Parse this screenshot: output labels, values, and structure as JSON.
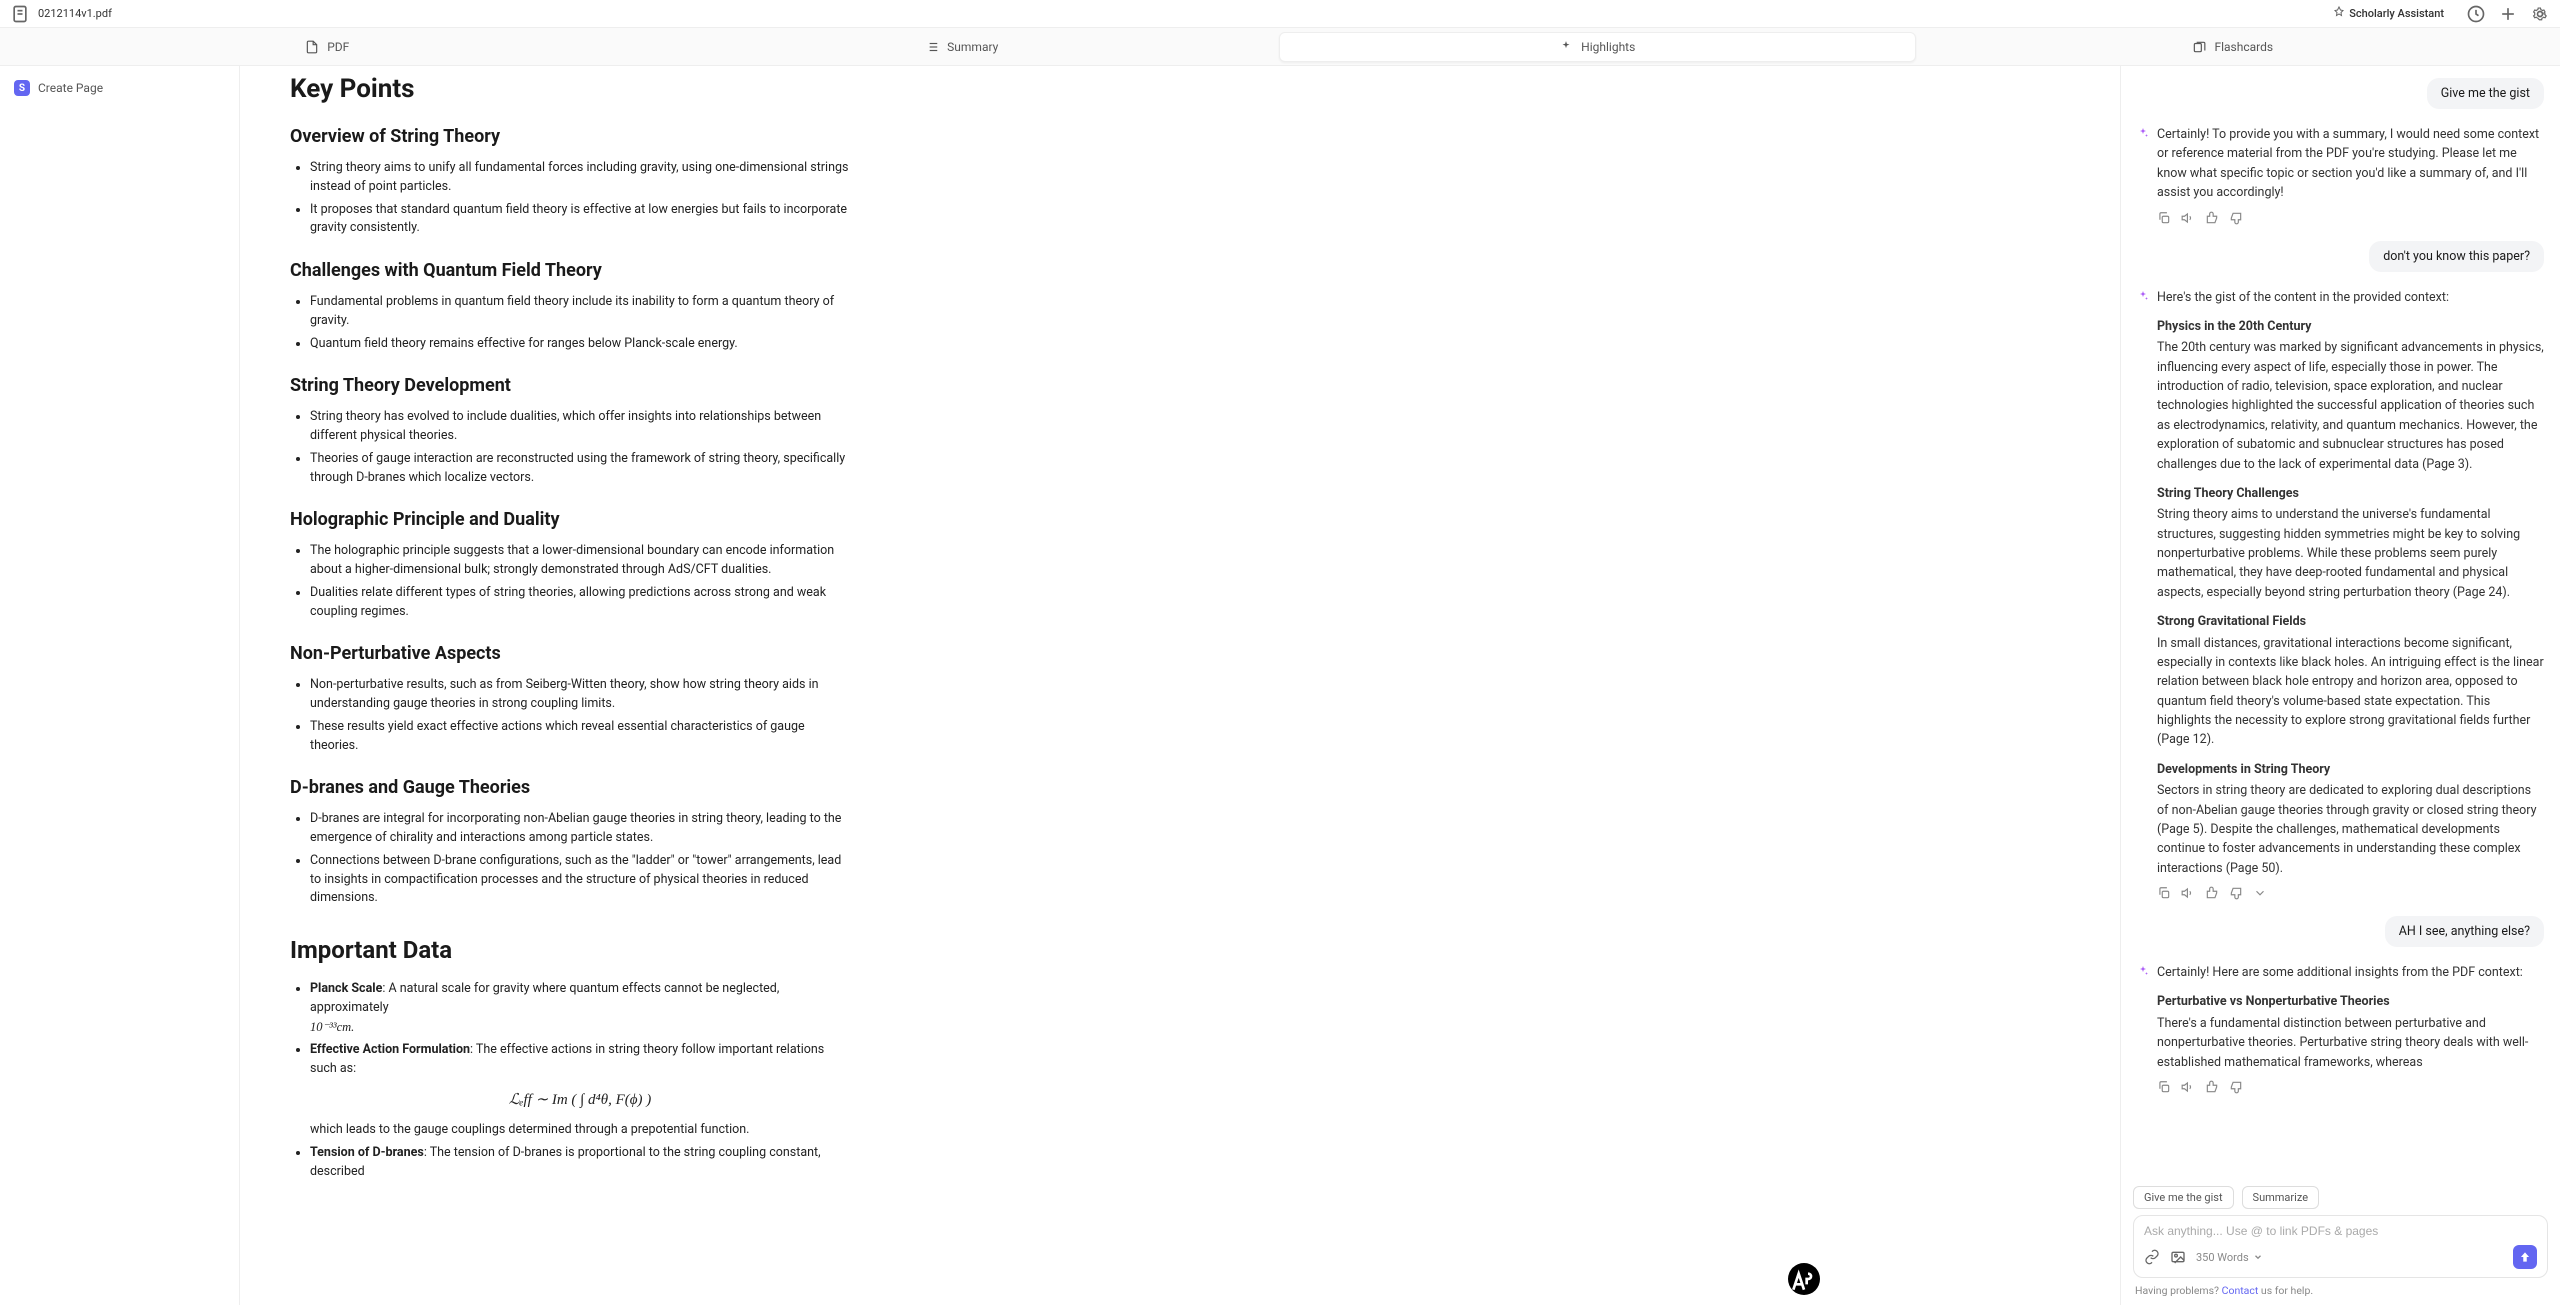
{
  "topbar": {
    "filename": "0212114v1.pdf",
    "assistant_label": "Scholarly Assistant"
  },
  "tabs": {
    "pdf": "PDF",
    "summary": "Summary",
    "highlights": "Highlights",
    "flashcards": "Flashcards"
  },
  "left_rail": {
    "create_page": "Create Page"
  },
  "content": {
    "ghost": "",
    "title": "Key Points",
    "sections": [
      {
        "heading": "Overview of String Theory",
        "items": [
          "String theory aims to unify all fundamental forces including gravity, using one-dimensional strings instead of point particles.",
          "It proposes that standard quantum field theory is effective at low energies but fails to incorporate gravity consistently."
        ]
      },
      {
        "heading": "Challenges with Quantum Field Theory",
        "items": [
          "Fundamental problems in quantum field theory include its inability to form a quantum theory of gravity.",
          "Quantum field theory remains effective for ranges below Planck-scale energy."
        ]
      },
      {
        "heading": "String Theory Development",
        "items": [
          "String theory has evolved to include dualities, which offer insights into relationships between different physical theories.",
          "Theories of gauge interaction are reconstructed using the framework of string theory, specifically through D-branes which localize vectors."
        ]
      },
      {
        "heading": "Holographic Principle and Duality",
        "items": [
          "The holographic principle suggests that a lower-dimensional boundary can encode information about a higher-dimensional bulk; strongly demonstrated through AdS/CFT dualities.",
          "Dualities relate different types of string theories, allowing predictions across strong and weak coupling regimes."
        ]
      },
      {
        "heading": "Non-Perturbative Aspects",
        "items": [
          "Non-perturbative results, such as from Seiberg-Witten theory, show how string theory aids in understanding gauge theories in strong coupling limits.",
          "These results yield exact effective actions which reveal essential characteristics of gauge theories."
        ]
      },
      {
        "heading": "D-branes and Gauge Theories",
        "items": [
          "D-branes are integral for incorporating non-Abelian gauge theories in string theory, leading to the emergence of chirality and interactions among particle states.",
          "Connections between D-brane configurations, such as the \"ladder\" or \"tower\" arrangements, lead to insights in compactification processes and the structure of physical theories in reduced dimensions."
        ]
      }
    ],
    "important_heading": "Important Data",
    "important": {
      "planck_label": "Planck Scale",
      "planck_text": ": A natural scale for gravity where quantum effects cannot be neglected, approximately ",
      "planck_math": "10⁻³³cm.",
      "action_label": "Effective Action Formulation",
      "action_text": ": The effective actions in string theory follow important relations such as:",
      "action_math": "ℒₑff ∼ Im ( ∫ d⁴θ, F(ϕ) )",
      "action_tail": "which leads to the gauge couplings determined through a prepotential function.",
      "tension_label": "Tension of D-branes",
      "tension_text": ": The tension of D-branes is proportional to the string coupling constant, described"
    }
  },
  "chat": {
    "messages": [
      {
        "role": "user",
        "text": "Give me the gist"
      },
      {
        "role": "ai",
        "text": "Certainly! To provide you with a summary, I would need some context or reference material from the PDF you're studying. Please let me know what specific topic or section you'd like a summary of, and I'll assist you accordingly!"
      },
      {
        "role": "user",
        "text": "don't you know this paper?"
      },
      {
        "role": "ai",
        "intro": "Here's the gist of the content in the provided context:",
        "sections": [
          {
            "title": "Physics in the 20th Century",
            "body": "The 20th century was marked by significant advancements in physics, influencing every aspect of life, especially those in power. The introduction of radio, television, space exploration, and nuclear technologies highlighted the successful application of theories such as electrodynamics, relativity, and quantum mechanics. However, the exploration of subatomic and subnuclear structures has posed challenges due to the lack of experimental data (Page 3)."
          },
          {
            "title": "String Theory Challenges",
            "body": "String theory aims to understand the universe's fundamental structures, suggesting hidden symmetries might be key to solving nonperturbative problems. While these problems seem purely mathematical, they have deep-rooted fundamental and physical aspects, especially beyond string perturbation theory (Page 24)."
          },
          {
            "title": "Strong Gravitational Fields",
            "body": "In small distances, gravitational interactions become significant, especially in contexts like black holes. An intriguing effect is the linear relation between black hole entropy and horizon area, opposed to quantum field theory's volume-based state expectation. This highlights the necessity to explore strong gravitational fields further (Page 12)."
          },
          {
            "title": "Developments in String Theory",
            "body": "Sectors in string theory are dedicated to exploring dual descriptions of non-Abelian gauge theories through gravity or closed string theory (Page 5). Despite the challenges, mathematical developments continue to foster advancements in understanding these complex interactions (Page 50)."
          }
        ]
      },
      {
        "role": "user",
        "text": "AH I see, anything else?"
      },
      {
        "role": "ai",
        "intro": "Certainly! Here are some additional insights from the PDF context:",
        "sections": [
          {
            "title": "Perturbative vs Nonperturbative Theories",
            "body": "There's a fundamental distinction between perturbative and nonperturbative theories. Perturbative string theory deals with well-established mathematical frameworks, whereas"
          }
        ]
      }
    ],
    "chips": {
      "gist": "Give me the gist",
      "summarize": "Summarize"
    },
    "input_placeholder": "Ask anything... Use @ to link PDFs & pages",
    "word_count": "350 Words",
    "help_prefix": "Having problems? ",
    "help_link": "Contact",
    "help_suffix": " us for help."
  }
}
